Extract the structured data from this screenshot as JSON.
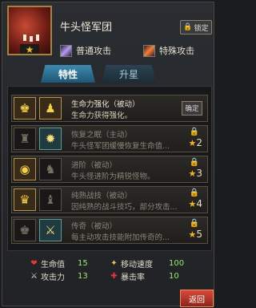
{
  "unit": {
    "name": "牛头怪军团",
    "stars": "★",
    "lock_label": "锁定"
  },
  "attacks": [
    {
      "label": "普通攻击"
    },
    {
      "label": "特殊攻击"
    }
  ],
  "tabs": [
    {
      "label": "特性"
    },
    {
      "label": "升星"
    }
  ],
  "skills": [
    {
      "title": "生命力强化（被动）",
      "desc": "生命力获得强化。",
      "button": "确定"
    },
    {
      "title": "恢复之眠（主动）",
      "desc": "牛头怪军团缓慢恢复生命值...",
      "star": "2"
    },
    {
      "title": "进阶（被动）",
      "desc": "牛头怪进阶为精锐怪物。",
      "star": "3"
    },
    {
      "title": "纯熟战技（被动）",
      "desc": "因纯熟的战斗技巧，部分攻击...",
      "star": "4"
    },
    {
      "title": "传奇（被动）",
      "desc": "每主动攻击技能附加传奇的...",
      "star": "5"
    }
  ],
  "stats": {
    "hp": {
      "label": "生命值",
      "value": "15"
    },
    "atk": {
      "label": "攻击力",
      "value": "13"
    },
    "speed": {
      "label": "移动速度",
      "value": "100"
    },
    "crit": {
      "label": "暴击率",
      "value": "10"
    }
  },
  "back_label": "返回",
  "colors": {
    "gold": "#f3b62a",
    "stat_value": "#9be86a",
    "tab_active": "#3e8ab0",
    "back_button": "#c23e30"
  }
}
